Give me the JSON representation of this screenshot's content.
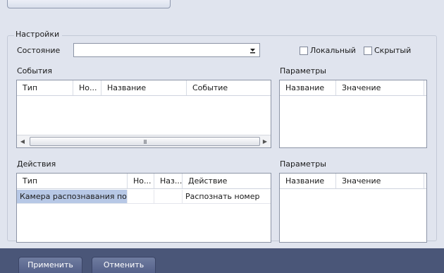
{
  "settings": {
    "group_title": "Настройки",
    "state_label": "Состояние",
    "state_value": "",
    "local_label": "Локальный",
    "hidden_label": "Скрытый"
  },
  "events": {
    "title": "События",
    "columns": [
      "Тип",
      "Но...",
      "Название",
      "Событие"
    ],
    "scroll_grip": "III",
    "params": {
      "title": "Параметры",
      "columns": [
        "Название",
        "Значение"
      ]
    }
  },
  "actions": {
    "title": "Действия",
    "columns": [
      "Тип",
      "Но...",
      "Наз...",
      "Действие"
    ],
    "rows": [
      {
        "type": "Камера распознавания по ...",
        "num": "",
        "name": "",
        "action": "Распознать номер"
      }
    ],
    "params": {
      "title": "Параметры",
      "columns": [
        "Название",
        "Значение"
      ]
    }
  },
  "footer": {
    "apply_label": "Применить",
    "cancel_label": "Отменить"
  }
}
